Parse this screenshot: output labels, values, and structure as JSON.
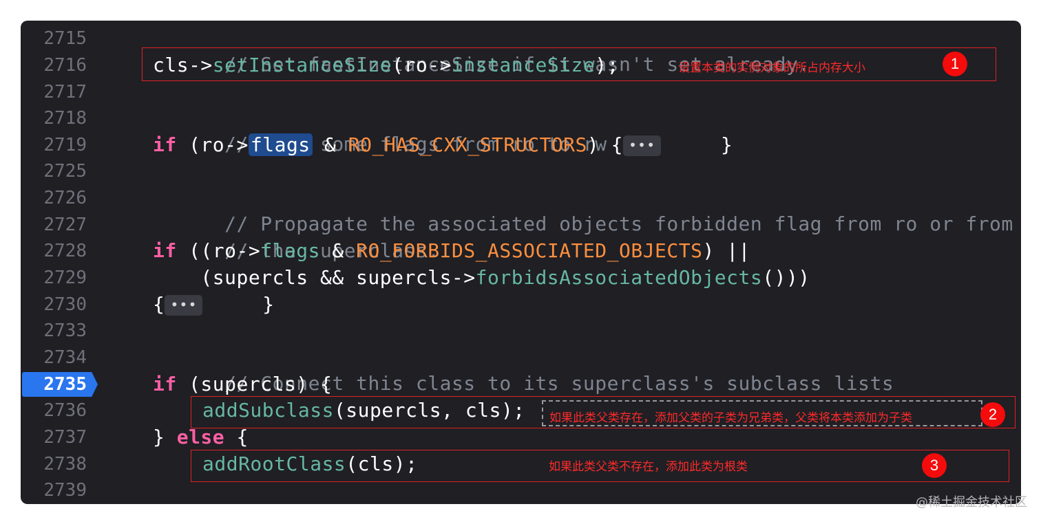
{
  "editor": {
    "line_numbers": [
      "2715",
      "2716",
      "2717",
      "2718",
      "2719",
      "2725",
      "2726",
      "2727",
      "2728",
      "2729",
      "2730",
      "2733",
      "2734",
      "2735",
      "2736",
      "2737",
      "2738",
      "2739"
    ],
    "current_line": "2735",
    "fold_label": "•••",
    "code": {
      "l2715": "// Set fastInstanceSize if it wasn't set already.",
      "l2716_a": "cls->",
      "l2716_fn1": "setInstanceSize",
      "l2716_b": "(ro->",
      "l2716_fn2": "instanceSize",
      "l2716_c": ");",
      "l2718": "// Copy some flags from ro to rw",
      "if_kw": "if",
      "l2719_a": " (ro->",
      "l2719_hl": "flags",
      "l2719_b": " & ",
      "l2719_mac": "RO_HAS_CXX_STRUCTORS",
      "l2719_c": ") {",
      "l2719_d": "     }",
      "l2726": "// Propagate the associated objects forbidden flag from ro or from",
      "l2727": "// the superclass.",
      "l2728_a": " ((ro->",
      "l2728_fn": "flags",
      "l2728_b": " & ",
      "l2728_mac": "RO_FORBIDS_ASSOCIATED_OBJECTS",
      "l2728_c": ") ||",
      "l2729_a": "    (supercls && supercls->",
      "l2729_fn": "forbidsAssociatedObjects",
      "l2729_b": "()))",
      "l2730_a": "{",
      "l2730_b": "     }",
      "l2734": "// Connect this class to its superclass's subclass lists",
      "l2735_a": " (supercls) {",
      "l2736_fn": "addSubclass",
      "l2736_a": "(supercls, cls);",
      "l2737_a": "} ",
      "else_kw": "else",
      "l2737_b": " {",
      "l2738_fn": "addRootClass",
      "l2738_a": "(cls);",
      "l2739": "}"
    }
  },
  "annotations": [
    {
      "number": "1",
      "text": "设置本类的实例对象的所占内存大小"
    },
    {
      "number": "2",
      "text": "如果此类父类存在，添加父类的子类为兄弟类，父类将本类添加为子类"
    },
    {
      "number": "3",
      "text": "如果此类父类不存在，添加此类为根类"
    }
  ],
  "watermark": "@稀土掘金技术社区",
  "colors": {
    "background": "#1f1f24",
    "keyword": "#fc5fa3",
    "function": "#67b7a4",
    "macro": "#fd8f3f",
    "comment": "#7f8590",
    "annotation": "#ff2a2a",
    "breakpoint": "#2a76ee"
  }
}
